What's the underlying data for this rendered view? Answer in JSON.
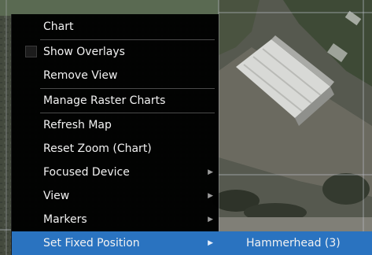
{
  "menu": {
    "items": [
      {
        "label": "Chart"
      },
      {
        "label": "Show Overlays",
        "checked": false
      },
      {
        "label": "Remove View"
      },
      {
        "label": "Manage Raster Charts"
      },
      {
        "label": "Refresh Map"
      },
      {
        "label": "Reset Zoom (Chart)"
      },
      {
        "label": "Focused Device",
        "has_submenu": true
      },
      {
        "label": "View",
        "has_submenu": true
      },
      {
        "label": "Markers",
        "has_submenu": true
      },
      {
        "label": "Set Fixed Position",
        "has_submenu": true,
        "highlighted": true
      }
    ],
    "submenu_arrow": "▶"
  },
  "submenu": {
    "items": [
      {
        "label": "Hammerhead (3)",
        "highlighted": true
      }
    ]
  },
  "colors": {
    "menu_bg": "#000000",
    "highlight": "#2a73c0",
    "text": "#f2f2f2"
  }
}
